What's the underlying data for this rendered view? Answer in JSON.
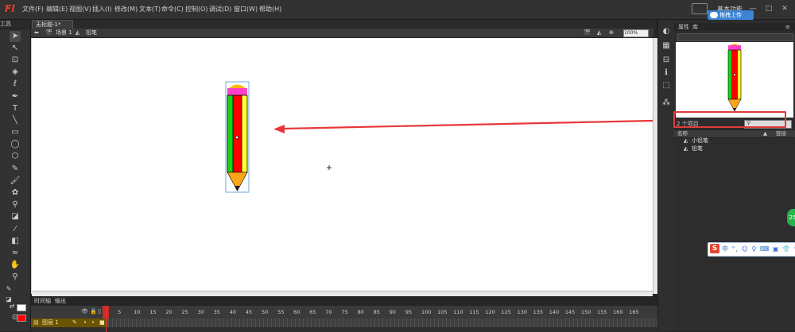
{
  "app": {
    "logo": "Fl",
    "menu": [
      "文件(F)",
      "编辑(E)",
      "视图(V)",
      "插入(I)",
      "修改(M)",
      "文本(T)",
      "命令(C)",
      "控制(O)",
      "调试(D)",
      "窗口(W)",
      "帮助(H)"
    ],
    "workspace_label": "基本功能",
    "upload_badge": "拖拽上传",
    "window_controls": [
      "—",
      "□",
      "✕"
    ]
  },
  "toolbox": {
    "tab_label": "工具"
  },
  "document": {
    "tab_label": "无标题-1*",
    "scene_label": "场景 1",
    "symbol_label": "铅笔",
    "zoom": "100%"
  },
  "timeline": {
    "tabs": [
      "时间轴",
      "输出"
    ],
    "frame_numbers": [
      "1",
      "5",
      "10",
      "15",
      "20",
      "25",
      "30",
      "35",
      "40",
      "45",
      "50",
      "55",
      "60",
      "65",
      "70",
      "75",
      "80",
      "85",
      "90",
      "95",
      "100",
      "105",
      "110",
      "115",
      "120",
      "125",
      "130",
      "135",
      "140",
      "145",
      "150",
      "155",
      "160",
      "165"
    ],
    "layer_name": "图层 1",
    "current_frame": 1
  },
  "library": {
    "tabs": [
      "属性",
      "库"
    ],
    "item_count": "2 个项目",
    "header_name": "名称",
    "header_linkage": "链接",
    "items": [
      {
        "name": "小铅笔"
      },
      {
        "name": "铅笔"
      }
    ]
  },
  "ime": {
    "logo": "S",
    "icons": "中 °, ☺ ♀ ⌨ ▣ 👕 ✎"
  },
  "side_bubble": "25",
  "colors": {
    "stroke": "#ffffff",
    "fill": "#ff0000",
    "arrow": "#e8383b",
    "highlight": "#e03a3a"
  }
}
